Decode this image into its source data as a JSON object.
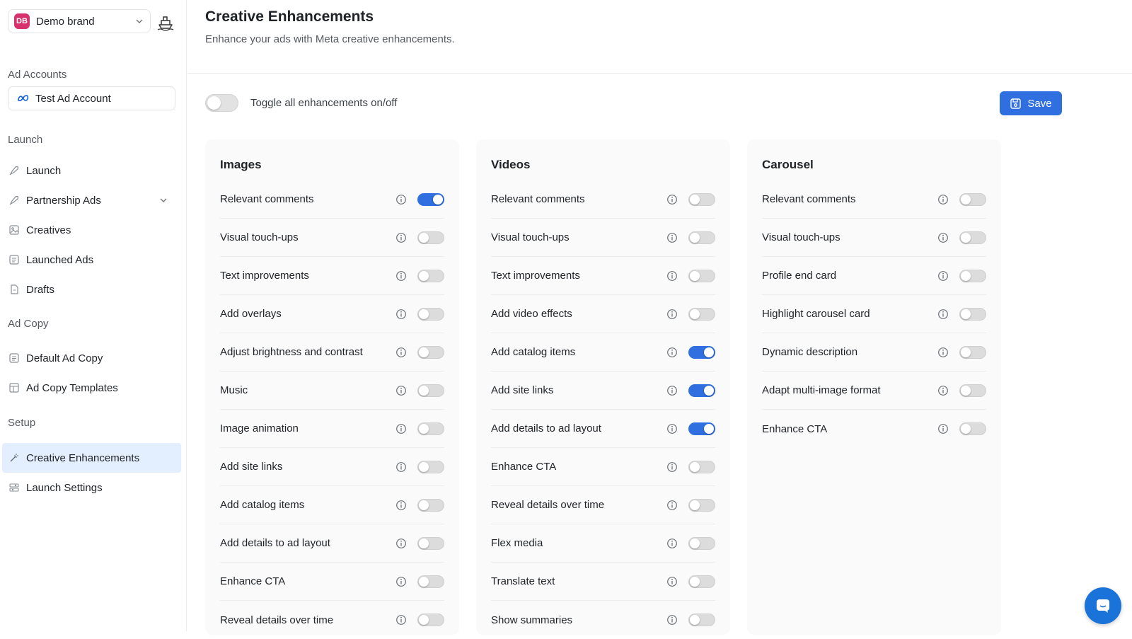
{
  "sidebar": {
    "brand": {
      "initials": "DB",
      "name": "Demo brand",
      "color": "#d6336c"
    },
    "sections": {
      "ad_accounts": "Ad Accounts",
      "launch": "Launch",
      "ad_copy": "Ad Copy",
      "setup": "Setup"
    },
    "account": {
      "label": "Test Ad Account",
      "icon": "meta-icon"
    },
    "nav": {
      "launch": {
        "label": "Launch",
        "icon": "rocket-icon"
      },
      "partnership_ads": {
        "label": "Partnership Ads",
        "icon": "rocket-icon"
      },
      "creatives": {
        "label": "Creatives",
        "icon": "image-icon"
      },
      "launched_ads": {
        "label": "Launched Ads",
        "icon": "list-icon"
      },
      "drafts": {
        "label": "Drafts",
        "icon": "file-icon"
      },
      "default_ad_copy": {
        "label": "Default Ad Copy",
        "icon": "list-icon"
      },
      "ad_copy_templates": {
        "label": "Ad Copy Templates",
        "icon": "layout-icon"
      },
      "creative_enhancements": {
        "label": "Creative Enhancements",
        "icon": "wand-icon",
        "active": true
      },
      "launch_settings": {
        "label": "Launch Settings",
        "icon": "sliders-icon"
      }
    }
  },
  "header": {
    "title": "Creative Enhancements",
    "subtitle": "Enhance your ads with Meta creative enhancements."
  },
  "toolbar": {
    "toggle_all_label": "Toggle all enhancements on/off",
    "toggle_all_on": false,
    "save_label": "Save"
  },
  "colors": {
    "accent": "#2f6fe0",
    "active_nav_bg": "#e3eefe"
  },
  "panels": [
    {
      "title": "Images",
      "items": [
        {
          "label": "Relevant comments",
          "on": true
        },
        {
          "label": "Visual touch-ups",
          "on": false
        },
        {
          "label": "Text improvements",
          "on": false
        },
        {
          "label": "Add overlays",
          "on": false
        },
        {
          "label": "Adjust brightness and contrast",
          "on": false
        },
        {
          "label": "Music",
          "on": false
        },
        {
          "label": "Image animation",
          "on": false
        },
        {
          "label": "Add site links",
          "on": false
        },
        {
          "label": "Add catalog items",
          "on": false
        },
        {
          "label": "Add details to ad layout",
          "on": false
        },
        {
          "label": "Enhance CTA",
          "on": false
        },
        {
          "label": "Reveal details over time",
          "on": false
        }
      ]
    },
    {
      "title": "Videos",
      "items": [
        {
          "label": "Relevant comments",
          "on": false
        },
        {
          "label": "Visual touch-ups",
          "on": false
        },
        {
          "label": "Text improvements",
          "on": false
        },
        {
          "label": "Add video effects",
          "on": false
        },
        {
          "label": "Add catalog items",
          "on": true
        },
        {
          "label": "Add site links",
          "on": true
        },
        {
          "label": "Add details to ad layout",
          "on": true
        },
        {
          "label": "Enhance CTA",
          "on": false
        },
        {
          "label": "Reveal details over time",
          "on": false
        },
        {
          "label": "Flex media",
          "on": false
        },
        {
          "label": "Translate text",
          "on": false
        },
        {
          "label": "Show summaries",
          "on": false
        }
      ]
    },
    {
      "title": "Carousel",
      "items": [
        {
          "label": "Relevant comments",
          "on": false
        },
        {
          "label": "Visual touch-ups",
          "on": false
        },
        {
          "label": "Profile end card",
          "on": false
        },
        {
          "label": "Highlight carousel card",
          "on": false
        },
        {
          "label": "Dynamic description",
          "on": false
        },
        {
          "label": "Adapt multi-image format",
          "on": false
        },
        {
          "label": "Enhance CTA",
          "on": false
        }
      ]
    }
  ],
  "chat": {
    "icon": "chat-icon"
  }
}
